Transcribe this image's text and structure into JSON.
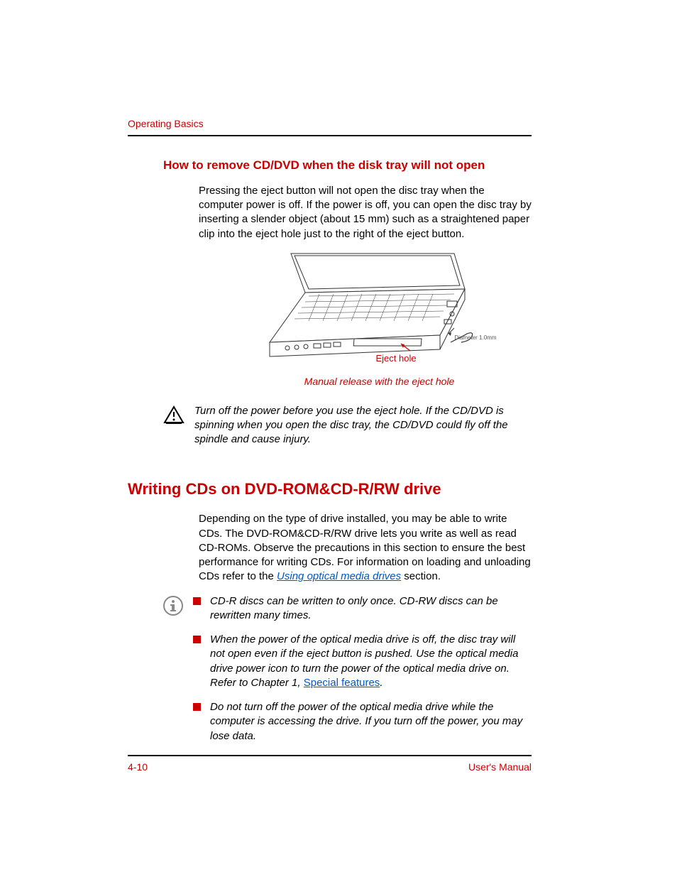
{
  "runningHead": "Operating Basics",
  "section1": {
    "heading": "How to remove CD/DVD when the disk tray will not open",
    "paragraph": "Pressing the eject button will not open the disc tray when the computer power is off. If the power is off, you can open the disc tray by inserting a slender object (about 15 mm) such as a straightened paper clip into the eject hole just to the right of the eject button.",
    "figure": {
      "ejectLabel": "Eject hole",
      "diameterLabel": "Diameter 1.0mm",
      "caption": "Manual release with the eject hole"
    },
    "warning": "Turn off the power before you use the eject hole. If the CD/DVD is spinning when you open the disc tray, the CD/DVD could fly off the spindle and cause injury."
  },
  "section2": {
    "heading": "Writing CDs on DVD-ROM&CD-R/RW drive",
    "paragraphPre": "Depending on the type of drive installed, you may be able to write CDs. The DVD-ROM&CD-R/RW drive lets you write as well as read CD-ROMs. Observe the precautions in this section to ensure the best performance for writing CDs. For information on loading and unloading CDs refer to the ",
    "paragraphLink": "Using optical media drives",
    "paragraphPost": " section.",
    "notes": [
      {
        "text": "CD-R discs can be written to only once. CD-RW discs can be rewritten many times."
      },
      {
        "pre": "When the power of the optical media drive is off, the disc tray will not open even if the eject button is pushed. Use the optical media drive power icon to turn the power of the optical media drive on. Refer to Chapter 1, ",
        "link": "Special features",
        "post": "."
      },
      {
        "text": "Do not turn off the power of the optical media drive while the computer is accessing the drive. If you turn off the power, you may lose data."
      }
    ]
  },
  "footer": {
    "pageNum": "4-10",
    "docTitle": "User's Manual"
  }
}
